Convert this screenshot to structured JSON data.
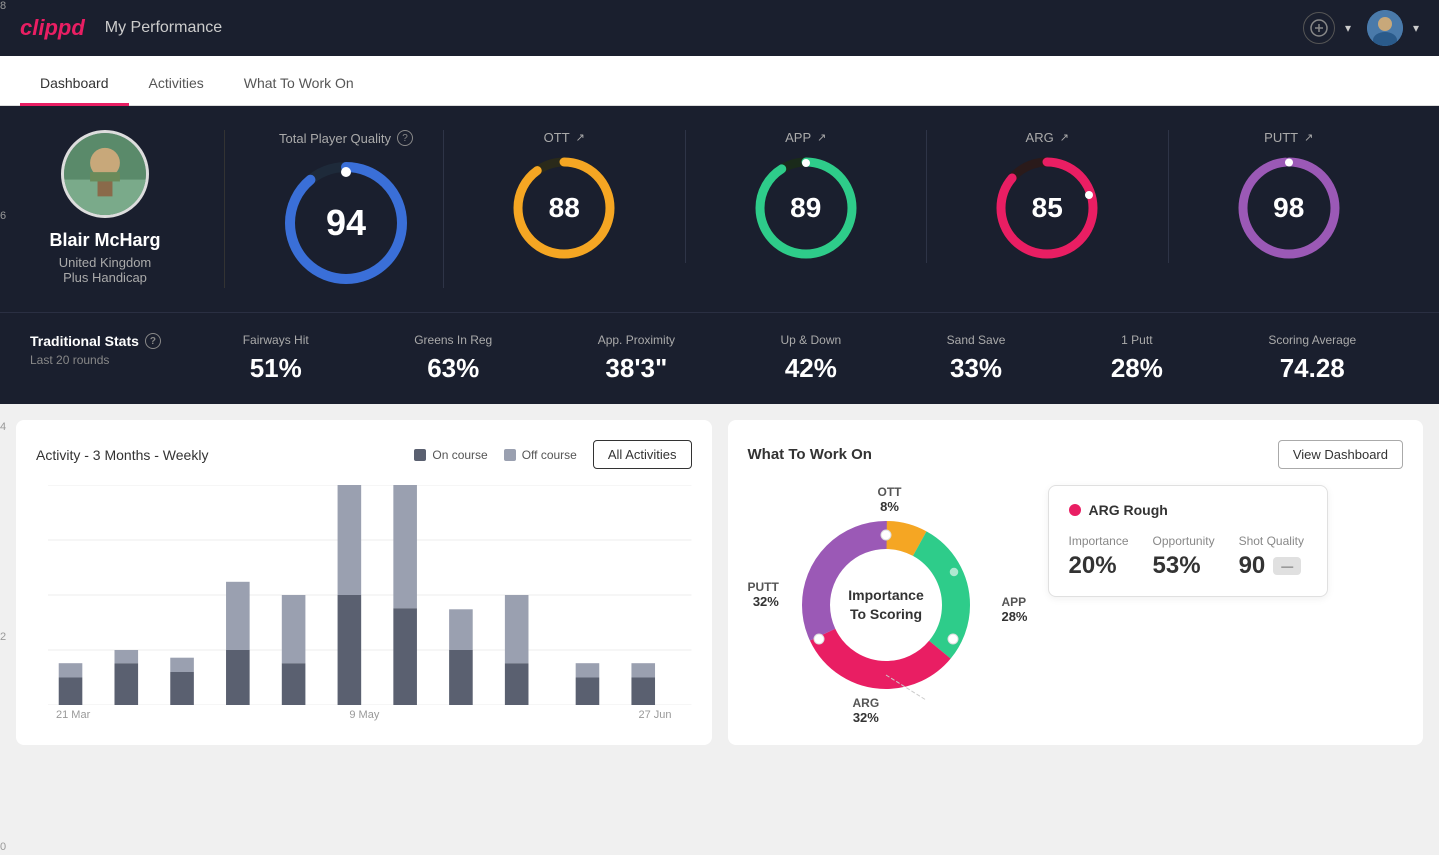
{
  "app": {
    "logo": "clippd",
    "nav_title": "My Performance"
  },
  "tabs": [
    {
      "id": "dashboard",
      "label": "Dashboard",
      "active": true
    },
    {
      "id": "activities",
      "label": "Activities",
      "active": false
    },
    {
      "id": "what-to-work-on",
      "label": "What To Work On",
      "active": false
    }
  ],
  "profile": {
    "name": "Blair McHarg",
    "country": "United Kingdom",
    "handicap": "Plus Handicap"
  },
  "total_quality": {
    "label": "Total Player Quality",
    "value": 94
  },
  "scores": [
    {
      "id": "ott",
      "label": "OTT",
      "value": 88,
      "color": "#f5a623",
      "track_color": "#3a3a2a"
    },
    {
      "id": "app",
      "label": "APP",
      "value": 89,
      "color": "#2ecc8a",
      "track_color": "#1a3a2a"
    },
    {
      "id": "arg",
      "label": "ARG",
      "value": 85,
      "color": "#e91e63",
      "track_color": "#3a1a2a"
    },
    {
      "id": "putt",
      "label": "PUTT",
      "value": 98,
      "color": "#9b59b6",
      "track_color": "#2a1a3a"
    }
  ],
  "traditional_stats": {
    "title": "Traditional Stats",
    "subtitle": "Last 20 rounds",
    "items": [
      {
        "label": "Fairways Hit",
        "value": "51%"
      },
      {
        "label": "Greens In Reg",
        "value": "63%"
      },
      {
        "label": "App. Proximity",
        "value": "38'3\""
      },
      {
        "label": "Up & Down",
        "value": "42%"
      },
      {
        "label": "Sand Save",
        "value": "33%"
      },
      {
        "label": "1 Putt",
        "value": "28%"
      },
      {
        "label": "Scoring Average",
        "value": "74.28"
      }
    ]
  },
  "activity_chart": {
    "title": "Activity - 3 Months - Weekly",
    "legend": [
      {
        "label": "On course",
        "color": "#5a6070"
      },
      {
        "label": "Off course",
        "color": "#9aa0b0"
      }
    ],
    "all_activities_btn": "All Activities",
    "y_labels": [
      "0",
      "2",
      "4",
      "6",
      "8"
    ],
    "x_labels": [
      "21 Mar",
      "9 May",
      "27 Jun"
    ],
    "bars": [
      {
        "on": 1.0,
        "off": 0.5
      },
      {
        "on": 1.5,
        "off": 0.5
      },
      {
        "on": 0.8,
        "off": 0.5
      },
      {
        "on": 1.2,
        "off": 2.5
      },
      {
        "on": 1.5,
        "off": 2.5
      },
      {
        "on": 4.0,
        "off": 5.0
      },
      {
        "on": 3.5,
        "off": 4.5
      },
      {
        "on": 2.0,
        "off": 1.5
      },
      {
        "on": 1.5,
        "off": 2.5
      },
      {
        "on": 0.5,
        "off": 0.5
      },
      {
        "on": 0.5,
        "off": 0.5
      }
    ]
  },
  "what_to_work_on": {
    "title": "What To Work On",
    "view_dashboard_btn": "View Dashboard",
    "donut_center": "Importance\nTo Scoring",
    "segments": [
      {
        "label": "OTT",
        "pct": "8%",
        "color": "#f5a623",
        "value": 8
      },
      {
        "label": "APP",
        "pct": "28%",
        "color": "#2ecc8a",
        "value": 28
      },
      {
        "label": "ARG",
        "pct": "32%",
        "color": "#e91e63",
        "value": 32
      },
      {
        "label": "PUTT",
        "pct": "32%",
        "color": "#9b59b6",
        "value": 32
      }
    ],
    "info_card": {
      "title": "ARG Rough",
      "dot_color": "#e91e63",
      "metrics": [
        {
          "label": "Importance",
          "value": "20%"
        },
        {
          "label": "Opportunity",
          "value": "53%"
        },
        {
          "label": "Shot Quality",
          "value": "90",
          "badge": true
        }
      ]
    }
  }
}
